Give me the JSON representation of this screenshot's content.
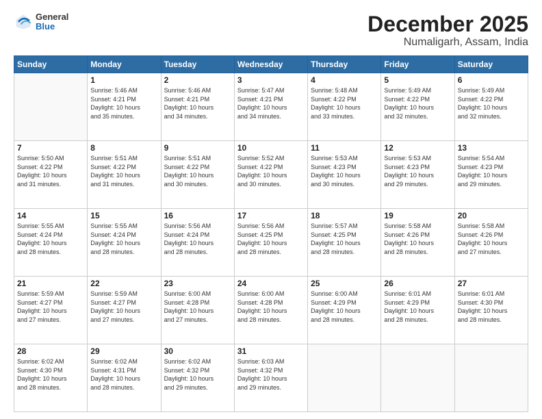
{
  "header": {
    "logo": {
      "line1": "General",
      "line2": "Blue"
    },
    "title": "December 2025",
    "subtitle": "Numaligarh, Assam, India"
  },
  "days_of_week": [
    "Sunday",
    "Monday",
    "Tuesday",
    "Wednesday",
    "Thursday",
    "Friday",
    "Saturday"
  ],
  "weeks": [
    [
      {
        "day": "",
        "info": ""
      },
      {
        "day": "1",
        "info": "Sunrise: 5:46 AM\nSunset: 4:21 PM\nDaylight: 10 hours\nand 35 minutes."
      },
      {
        "day": "2",
        "info": "Sunrise: 5:46 AM\nSunset: 4:21 PM\nDaylight: 10 hours\nand 34 minutes."
      },
      {
        "day": "3",
        "info": "Sunrise: 5:47 AM\nSunset: 4:21 PM\nDaylight: 10 hours\nand 34 minutes."
      },
      {
        "day": "4",
        "info": "Sunrise: 5:48 AM\nSunset: 4:22 PM\nDaylight: 10 hours\nand 33 minutes."
      },
      {
        "day": "5",
        "info": "Sunrise: 5:49 AM\nSunset: 4:22 PM\nDaylight: 10 hours\nand 32 minutes."
      },
      {
        "day": "6",
        "info": "Sunrise: 5:49 AM\nSunset: 4:22 PM\nDaylight: 10 hours\nand 32 minutes."
      }
    ],
    [
      {
        "day": "7",
        "info": "Sunrise: 5:50 AM\nSunset: 4:22 PM\nDaylight: 10 hours\nand 31 minutes."
      },
      {
        "day": "8",
        "info": "Sunrise: 5:51 AM\nSunset: 4:22 PM\nDaylight: 10 hours\nand 31 minutes."
      },
      {
        "day": "9",
        "info": "Sunrise: 5:51 AM\nSunset: 4:22 PM\nDaylight: 10 hours\nand 30 minutes."
      },
      {
        "day": "10",
        "info": "Sunrise: 5:52 AM\nSunset: 4:22 PM\nDaylight: 10 hours\nand 30 minutes."
      },
      {
        "day": "11",
        "info": "Sunrise: 5:53 AM\nSunset: 4:23 PM\nDaylight: 10 hours\nand 30 minutes."
      },
      {
        "day": "12",
        "info": "Sunrise: 5:53 AM\nSunset: 4:23 PM\nDaylight: 10 hours\nand 29 minutes."
      },
      {
        "day": "13",
        "info": "Sunrise: 5:54 AM\nSunset: 4:23 PM\nDaylight: 10 hours\nand 29 minutes."
      }
    ],
    [
      {
        "day": "14",
        "info": "Sunrise: 5:55 AM\nSunset: 4:24 PM\nDaylight: 10 hours\nand 28 minutes."
      },
      {
        "day": "15",
        "info": "Sunrise: 5:55 AM\nSunset: 4:24 PM\nDaylight: 10 hours\nand 28 minutes."
      },
      {
        "day": "16",
        "info": "Sunrise: 5:56 AM\nSunset: 4:24 PM\nDaylight: 10 hours\nand 28 minutes."
      },
      {
        "day": "17",
        "info": "Sunrise: 5:56 AM\nSunset: 4:25 PM\nDaylight: 10 hours\nand 28 minutes."
      },
      {
        "day": "18",
        "info": "Sunrise: 5:57 AM\nSunset: 4:25 PM\nDaylight: 10 hours\nand 28 minutes."
      },
      {
        "day": "19",
        "info": "Sunrise: 5:58 AM\nSunset: 4:26 PM\nDaylight: 10 hours\nand 28 minutes."
      },
      {
        "day": "20",
        "info": "Sunrise: 5:58 AM\nSunset: 4:26 PM\nDaylight: 10 hours\nand 27 minutes."
      }
    ],
    [
      {
        "day": "21",
        "info": "Sunrise: 5:59 AM\nSunset: 4:27 PM\nDaylight: 10 hours\nand 27 minutes."
      },
      {
        "day": "22",
        "info": "Sunrise: 5:59 AM\nSunset: 4:27 PM\nDaylight: 10 hours\nand 27 minutes."
      },
      {
        "day": "23",
        "info": "Sunrise: 6:00 AM\nSunset: 4:28 PM\nDaylight: 10 hours\nand 27 minutes."
      },
      {
        "day": "24",
        "info": "Sunrise: 6:00 AM\nSunset: 4:28 PM\nDaylight: 10 hours\nand 28 minutes."
      },
      {
        "day": "25",
        "info": "Sunrise: 6:00 AM\nSunset: 4:29 PM\nDaylight: 10 hours\nand 28 minutes."
      },
      {
        "day": "26",
        "info": "Sunrise: 6:01 AM\nSunset: 4:29 PM\nDaylight: 10 hours\nand 28 minutes."
      },
      {
        "day": "27",
        "info": "Sunrise: 6:01 AM\nSunset: 4:30 PM\nDaylight: 10 hours\nand 28 minutes."
      }
    ],
    [
      {
        "day": "28",
        "info": "Sunrise: 6:02 AM\nSunset: 4:30 PM\nDaylight: 10 hours\nand 28 minutes."
      },
      {
        "day": "29",
        "info": "Sunrise: 6:02 AM\nSunset: 4:31 PM\nDaylight: 10 hours\nand 28 minutes."
      },
      {
        "day": "30",
        "info": "Sunrise: 6:02 AM\nSunset: 4:32 PM\nDaylight: 10 hours\nand 29 minutes."
      },
      {
        "day": "31",
        "info": "Sunrise: 6:03 AM\nSunset: 4:32 PM\nDaylight: 10 hours\nand 29 minutes."
      },
      {
        "day": "",
        "info": ""
      },
      {
        "day": "",
        "info": ""
      },
      {
        "day": "",
        "info": ""
      }
    ]
  ]
}
